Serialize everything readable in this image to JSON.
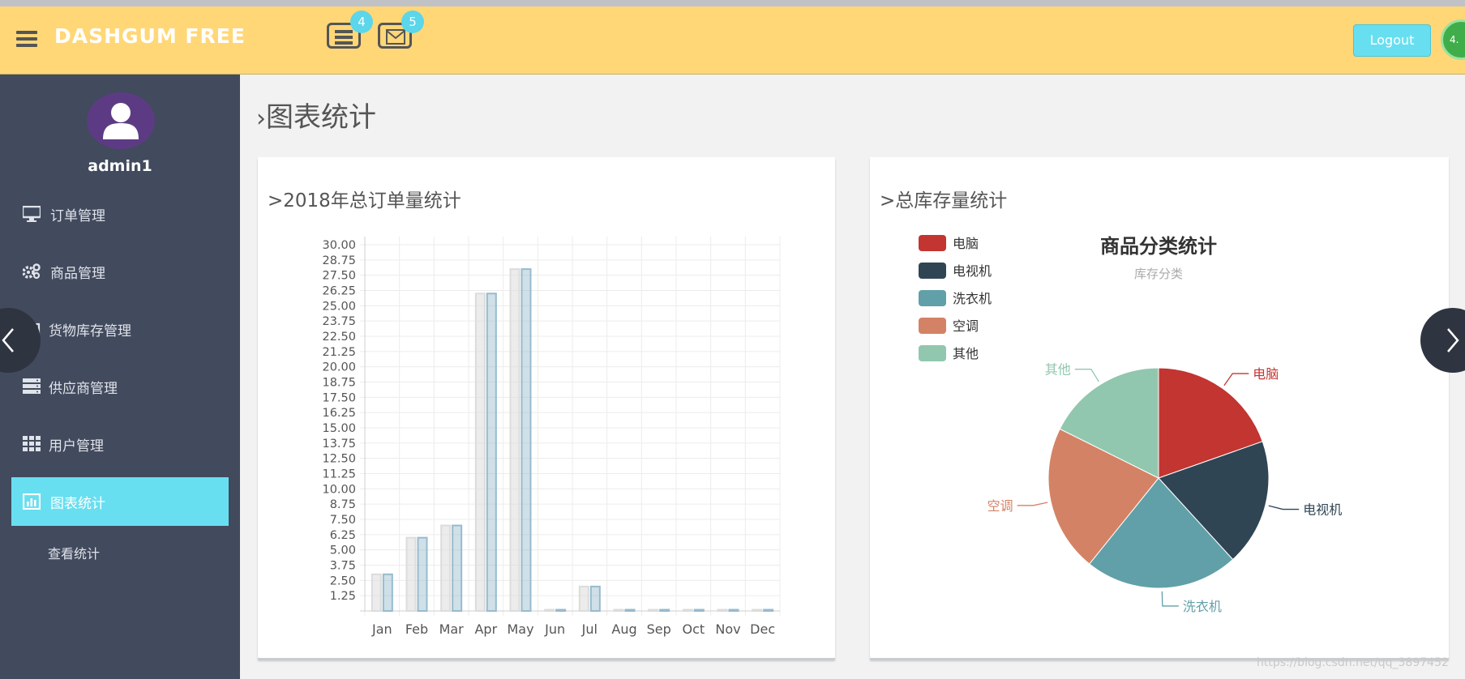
{
  "header": {
    "brand": "DASHGUM FREE",
    "tasks_badge": "4",
    "mail_badge": "5",
    "logout_label": "Logout",
    "corner_badge": "4.",
    "menu_icon": "hamburger-icon",
    "tasks_icon": "tasks-icon",
    "mail_icon": "envelope-icon",
    "color": "#ffd777"
  },
  "sidebar": {
    "username": "admin1",
    "items": [
      {
        "label": "订单管理",
        "icon": "desktop-icon"
      },
      {
        "label": "商品管理",
        "icon": "gears-icon"
      },
      {
        "label": "货物库存管理",
        "icon": "box-icon"
      },
      {
        "label": "供应商管理",
        "icon": "server-icon"
      },
      {
        "label": "用户管理",
        "icon": "grid-icon"
      },
      {
        "label": "图表统计",
        "icon": "bar-chart-icon"
      }
    ],
    "active_index": 5,
    "sub_item": "查看统计",
    "active_color": "#68dff0",
    "bg_color": "#424a5d"
  },
  "main": {
    "page_title": "图表统计",
    "left_panel_title": ">2018年总订单量统计",
    "right_panel_title": ">总库存量统计"
  },
  "watermark": "https://blog.csdn.net/qq_3897452",
  "chart_data": [
    {
      "type": "bar",
      "categories": [
        "Jan",
        "Feb",
        "Mar",
        "Apr",
        "May",
        "Jun",
        "Jul",
        "Aug",
        "Sep",
        "Oct",
        "Nov",
        "Dec"
      ],
      "series": [
        {
          "values": [
            3,
            6,
            7,
            26,
            28,
            0,
            2,
            0,
            0,
            0,
            0,
            0
          ],
          "color": "#dcdcdc"
        },
        {
          "values": [
            3,
            6,
            7,
            26,
            28,
            0,
            2,
            0,
            0,
            0,
            0,
            0
          ],
          "color": "#97bbcd"
        }
      ],
      "yticks": [
        "1.25",
        "2.50",
        "3.75",
        "5.00",
        "6.25",
        "7.50",
        "8.75",
        "10.00",
        "11.25",
        "12.50",
        "13.75",
        "15.00",
        "16.25",
        "17.50",
        "18.75",
        "20.00",
        "21.25",
        "22.50",
        "23.75",
        "25.00",
        "26.25",
        "27.50",
        "28.75",
        "30.00"
      ],
      "ylim": [
        0,
        30
      ],
      "grid": true
    },
    {
      "type": "pie",
      "title": "商品分类统计",
      "subtitle": "库存分类",
      "legend_position": "top-left",
      "slices": [
        {
          "label": "电脑",
          "value": 20,
          "color": "#c23531"
        },
        {
          "label": "电视机",
          "value": 19,
          "color": "#2f4554"
        },
        {
          "label": "洗衣机",
          "value": 23,
          "color": "#61a0a8"
        },
        {
          "label": "空调",
          "value": 22,
          "color": "#d48265"
        },
        {
          "label": "其他",
          "value": 18,
          "color": "#91c7ae"
        }
      ]
    }
  ]
}
